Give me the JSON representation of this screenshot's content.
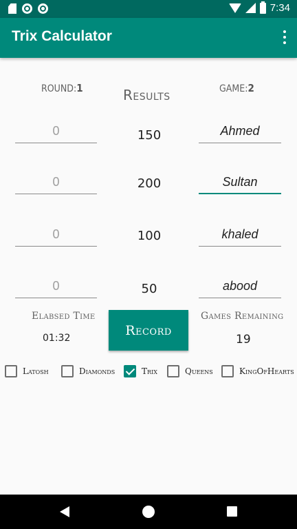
{
  "status_bar": {
    "time": "7:34"
  },
  "app_bar": {
    "title": "Trix Calculator"
  },
  "header": {
    "round_label": "ROUND:",
    "round_value": "1",
    "results_title": "Results",
    "game_label": "GAME:",
    "game_value": "2"
  },
  "players": [
    {
      "score_placeholder": "0",
      "result": "150",
      "name": "Ahmed"
    },
    {
      "score_placeholder": "0",
      "result": "200",
      "name": "Sultan"
    },
    {
      "score_placeholder": "0",
      "result": "100",
      "name": "khaled"
    },
    {
      "score_placeholder": "0",
      "result": "50",
      "name": "abood"
    }
  ],
  "stats": {
    "elapsed_label": "Elabsed Time",
    "elapsed_value": "01:32",
    "record_button": "Record",
    "games_remaining_label": "Games Remaining",
    "games_remaining_value": "19"
  },
  "contracts": [
    {
      "label": "Latosh",
      "checked": false
    },
    {
      "label": "Diamonds",
      "checked": false
    },
    {
      "label": "Trix",
      "checked": true
    },
    {
      "label": "Queens",
      "checked": false
    },
    {
      "label": "KingOfHearts",
      "checked": false
    }
  ],
  "colors": {
    "primary": "#00897b",
    "primary_dark": "#00695f",
    "background": "#fafafa"
  }
}
